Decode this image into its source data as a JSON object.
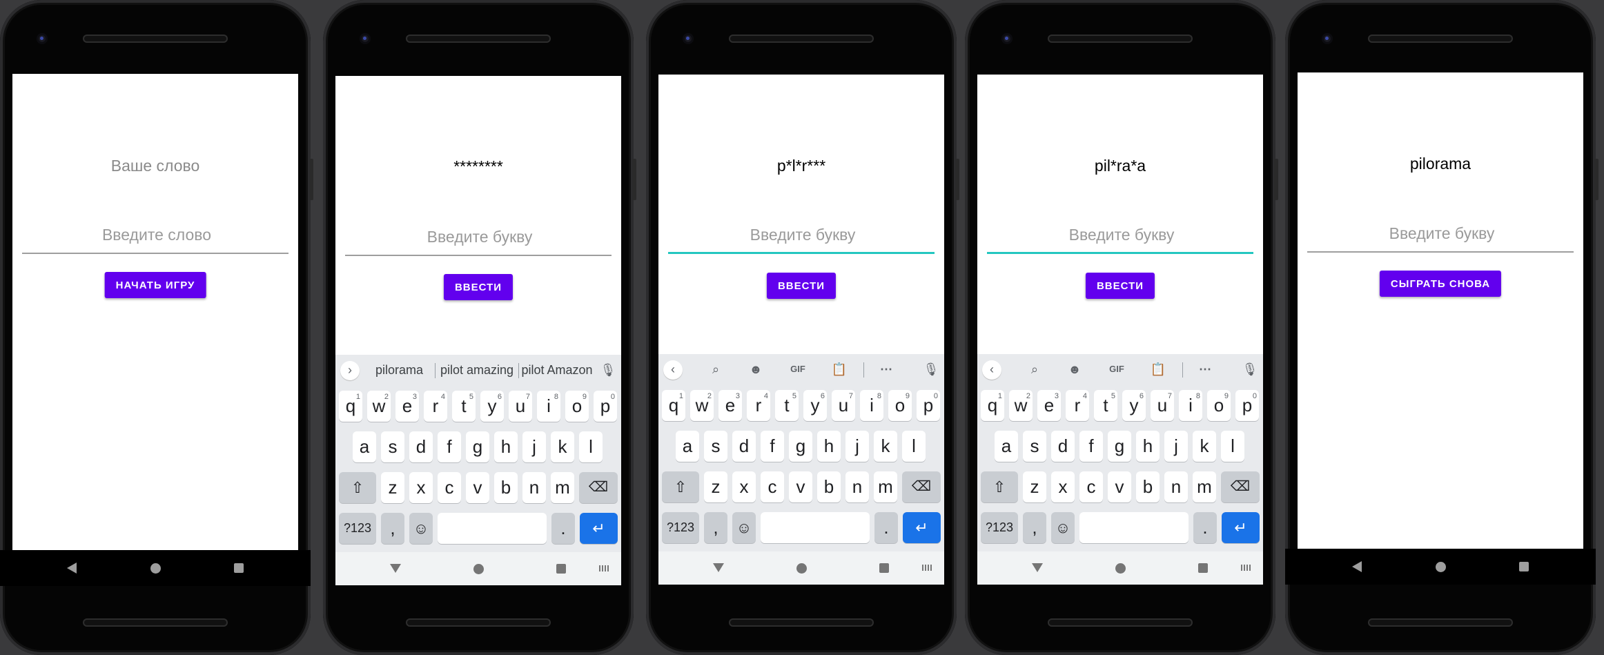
{
  "phones": [
    {
      "title": "Ваше слово",
      "input_placeholder": "Введите слово",
      "button": "НАЧАТЬ ИГРУ"
    },
    {
      "title": "********",
      "input_placeholder": "Введите букву",
      "button": "ВВЕСТИ",
      "suggestions": [
        "pilorama",
        "pilot amazing",
        "pilot Amazon"
      ]
    },
    {
      "title": "p*l*r***",
      "input_placeholder": "Введите букву",
      "button": "ВВЕСТИ",
      "toolbar": {
        "gif": "GIF"
      }
    },
    {
      "title": "pil*ra*a",
      "input_placeholder": "Введите букву",
      "button": "ВВЕСТИ",
      "toolbar": {
        "gif": "GIF"
      }
    },
    {
      "title": "pilorama",
      "input_placeholder": "Введите букву",
      "button": "СЫГРАТЬ СНОВА"
    }
  ],
  "keyboard": {
    "row1": [
      [
        "q",
        "1"
      ],
      [
        "w",
        "2"
      ],
      [
        "e",
        "3"
      ],
      [
        "r",
        "4"
      ],
      [
        "t",
        "5"
      ],
      [
        "y",
        "6"
      ],
      [
        "u",
        "7"
      ],
      [
        "i",
        "8"
      ],
      [
        "o",
        "9"
      ],
      [
        "p",
        "0"
      ]
    ],
    "row2": [
      "a",
      "s",
      "d",
      "f",
      "g",
      "h",
      "j",
      "k",
      "l"
    ],
    "row3": [
      "z",
      "x",
      "c",
      "v",
      "b",
      "n",
      "m"
    ],
    "symbols_label": "?123",
    "comma": ",",
    "period": "."
  },
  "colors": {
    "accent": "#6200ee",
    "focus_line": "#24c7c0",
    "enter_key": "#1a73e8"
  }
}
